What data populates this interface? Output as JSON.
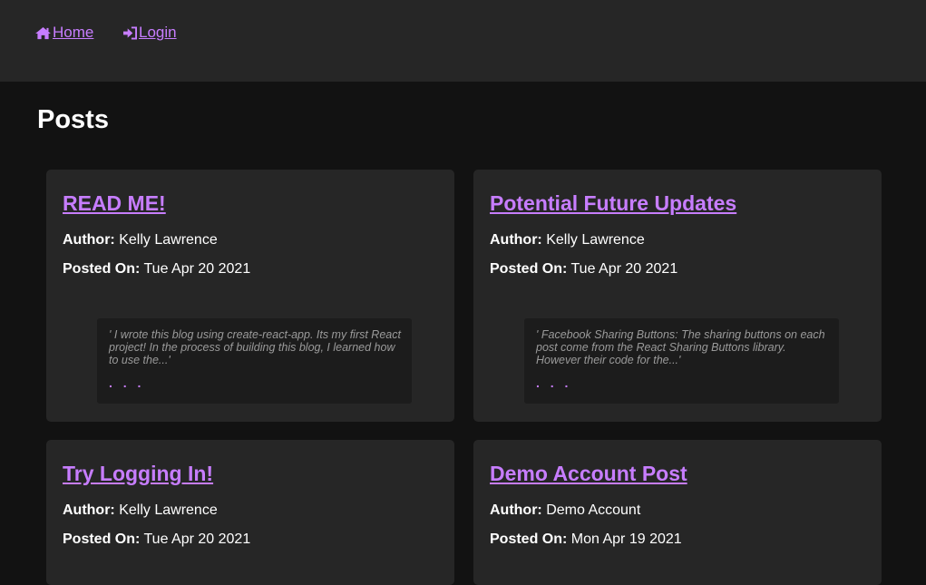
{
  "nav": {
    "home_label": "Home",
    "login_label": "Login",
    "home_icon": "home-icon",
    "login_icon": "sign-in-icon"
  },
  "page": {
    "title": "Posts"
  },
  "colors": {
    "accent": "#c77dff",
    "background": "#121212",
    "card": "#262626",
    "topbar": "#262626"
  },
  "posts": [
    {
      "title": "READ ME!",
      "author_label": "Author:",
      "author": "Kelly Lawrence",
      "posted_label": "Posted On:",
      "posted_on": "Tue Apr 20 2021",
      "excerpt": "' I wrote this blog using create-react-app. Its my first React project! In the process of building this blog, I learned how to use the...'",
      "more": ". . ."
    },
    {
      "title": "Potential Future Updates",
      "author_label": "Author:",
      "author": "Kelly Lawrence",
      "posted_label": "Posted On:",
      "posted_on": "Tue Apr 20 2021",
      "excerpt": "' Facebook Sharing Buttons: The sharing buttons on each post come from the React Sharing Buttons library. However their code for the...'",
      "more": ". . ."
    },
    {
      "title": "Try Logging In!",
      "author_label": "Author:",
      "author": "Kelly Lawrence",
      "posted_label": "Posted On:",
      "posted_on": "Tue Apr 20 2021"
    },
    {
      "title": "Demo Account Post",
      "author_label": "Author:",
      "author": "Demo Account",
      "posted_label": "Posted On:",
      "posted_on": "Mon Apr 19 2021"
    }
  ]
}
